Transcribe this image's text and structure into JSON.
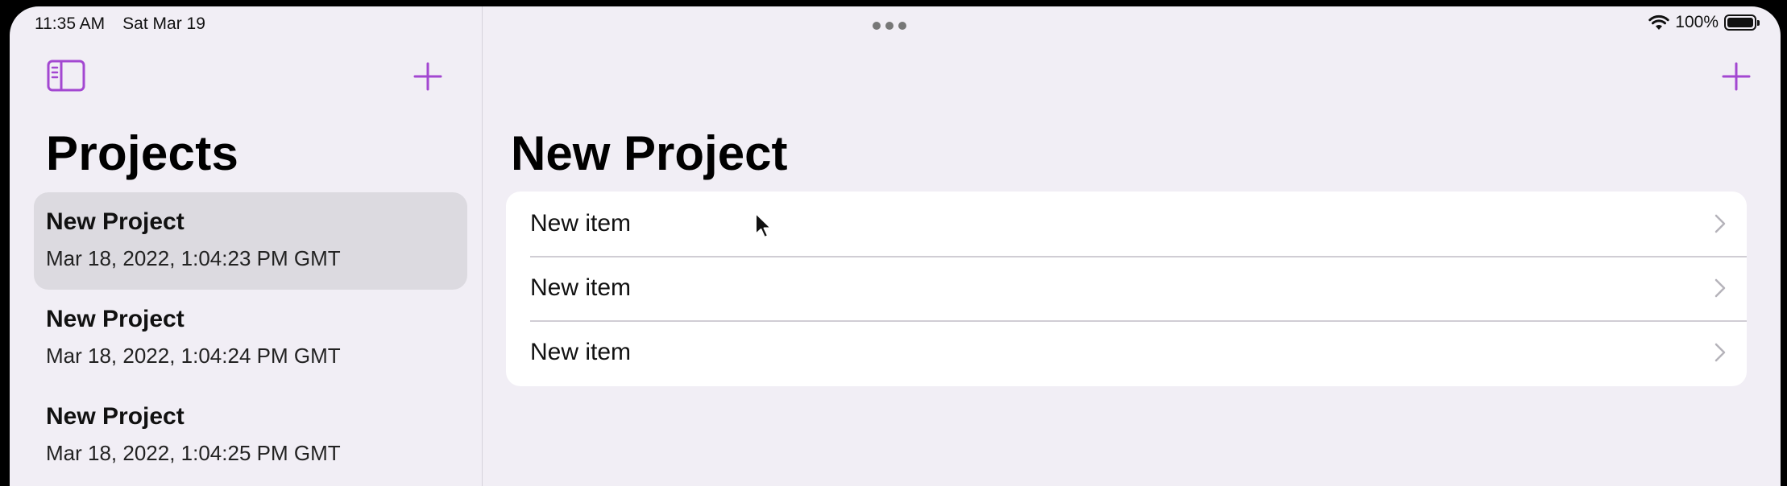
{
  "status_bar": {
    "time": "11:35 AM",
    "date": "Sat Mar 19",
    "battery": "100%",
    "icons": [
      "wifi-icon",
      "battery-icon"
    ]
  },
  "colors": {
    "accent": "#a347d1",
    "background": "#f1eef5",
    "selected_row": "#dcdae0",
    "card": "#ffffff"
  },
  "sidebar": {
    "title": "Projects",
    "toggle_icon": "sidebar-icon",
    "add_icon": "plus-icon",
    "projects": [
      {
        "name": "New Project",
        "date": "Mar 18, 2022, 1:04:23 PM GMT",
        "selected": true
      },
      {
        "name": "New Project",
        "date": "Mar 18, 2022, 1:04:24 PM GMT",
        "selected": false
      },
      {
        "name": "New Project",
        "date": "Mar 18, 2022, 1:04:25 PM GMT",
        "selected": false
      }
    ]
  },
  "detail": {
    "title": "New Project",
    "add_icon": "plus-icon",
    "items": [
      {
        "label": "New item"
      },
      {
        "label": "New item"
      },
      {
        "label": "New item"
      }
    ]
  }
}
